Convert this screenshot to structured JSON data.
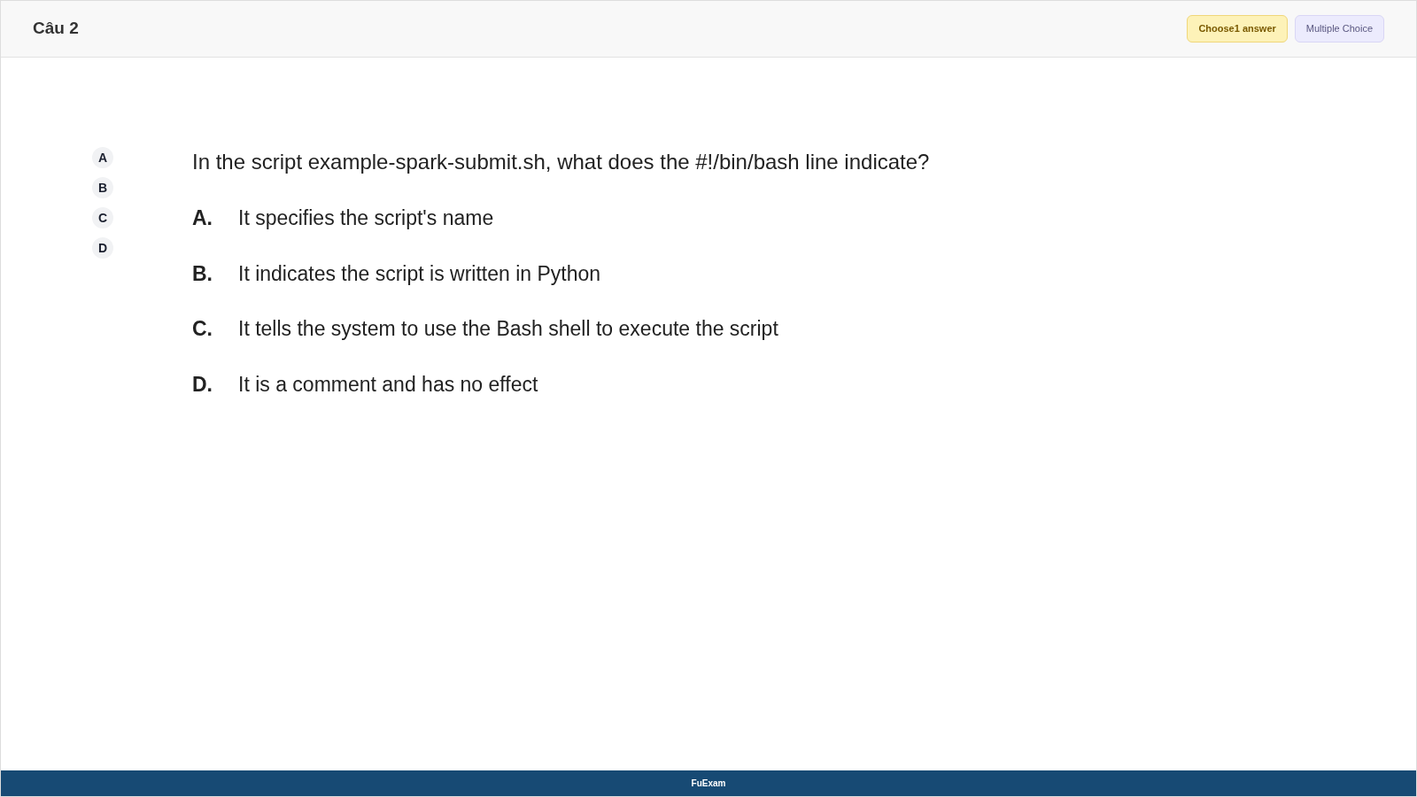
{
  "header": {
    "title": "Câu 2",
    "badges": [
      {
        "label": "Choose1 answer",
        "kind": "count"
      },
      {
        "label": "Multiple Choice",
        "kind": "type"
      }
    ]
  },
  "answer_buttons": [
    "A",
    "B",
    "C",
    "D"
  ],
  "question": {
    "text": "In the script example-spark-submit.sh, what does the #!/bin/bash line indicate?",
    "options": [
      {
        "letter": "A.",
        "text": "It specifies the script's name"
      },
      {
        "letter": "B.",
        "text": "It indicates the script is written in Python"
      },
      {
        "letter": "C.",
        "text": "It tells the system to use the Bash shell to execute the script"
      },
      {
        "letter": "D.",
        "text": "It is a comment and has no effect"
      }
    ]
  },
  "footer": {
    "text": "FuExam"
  }
}
